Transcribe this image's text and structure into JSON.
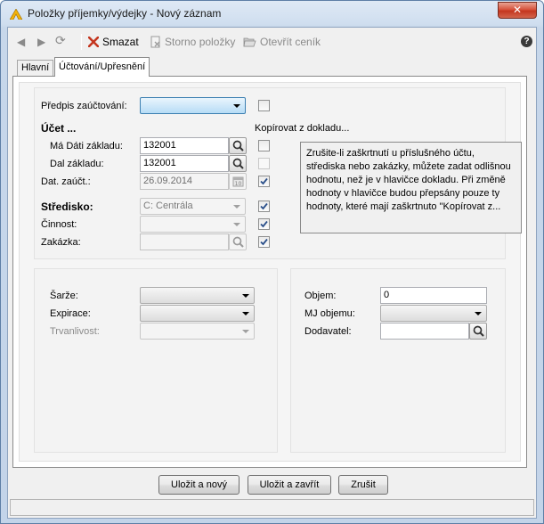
{
  "window": {
    "title": "Položky příjemky/výdejky - Nový záznam",
    "close_label": "✕"
  },
  "toolbar": {
    "back": "◀",
    "forward": "▶",
    "refresh": "⟳",
    "delete_label": "Smazat",
    "storno_label": "Storno položky",
    "open_label": "Otevřít ceník",
    "help_label": "?"
  },
  "tabs": [
    {
      "label": "Hlavní"
    },
    {
      "label": "Účtování/Upřesnění"
    }
  ],
  "accounting": {
    "predpis_label": "Předpis zaúčtování:",
    "ucet_label": "Účet ...",
    "copy_from_doc_label": "Kopírovat z dokladu...",
    "ma_dati_label": "Má Dáti základu:",
    "ma_dati_value": "132001",
    "dal_label": "Dal základu:",
    "dal_value": "132001",
    "dat_zauct_label": "Dat. zaúčt.:",
    "dat_zauct_value": "26.09.2014",
    "stredisko_label": "Středisko:",
    "stredisko_value": "C: Centrála",
    "cinnost_label": "Činnost:",
    "zakazka_label": "Zakázka:",
    "info_text": "Zrušite-li zaškrtnutí u příslušného účtu, střediska nebo zakázky, můžete zadat odlišnou hodnotu, než je v hlavičce dokladu. Při změně hodnoty v hlavičce budou přepsány pouze ty hodnoty, které mají zaškrtnuto \"Kopírovat z..."
  },
  "batch": {
    "sarze_label": "Šarže:",
    "expirace_label": "Expirace:",
    "trvanlivost_label": "Trvanlivost:"
  },
  "volume": {
    "objem_label": "Objem:",
    "objem_value": "0",
    "mj_label": "MJ objemu:",
    "dodavatel_label": "Dodavatel:"
  },
  "buttons": {
    "save_new": "Uložit a nový",
    "save_close": "Uložit a zavřít",
    "cancel": "Zrušit"
  },
  "colors": {
    "accent": "#c4361f",
    "selected_blue": "#b6dcf6"
  }
}
